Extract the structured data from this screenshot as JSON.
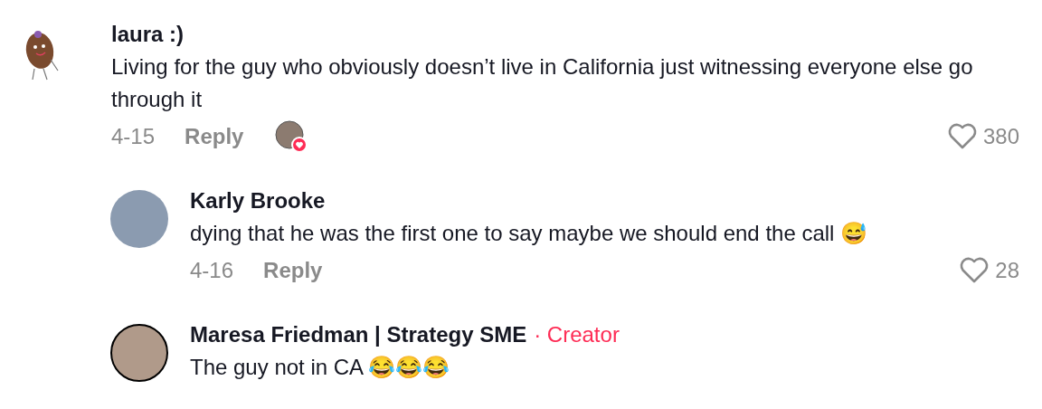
{
  "comment": {
    "author": "laura :)",
    "text": "Living for the guy who obviously doesn’t live in California just witnessing everyone else go through it",
    "date": "4-15",
    "reply_label": "Reply",
    "liked_by_creator": true,
    "likes": "380"
  },
  "replies": [
    {
      "author": "Karly Brooke",
      "text": "dying that he was the first one to say maybe we should end the call 😅",
      "date": "4-16",
      "reply_label": "Reply",
      "likes": "28",
      "liked_by_creator": false
    },
    {
      "author": "Maresa Friedman | Strategy SME",
      "creator_tag": "· Creator",
      "text": "The guy not in CA 😂😂😂",
      "liked_by_creator": false
    }
  ]
}
